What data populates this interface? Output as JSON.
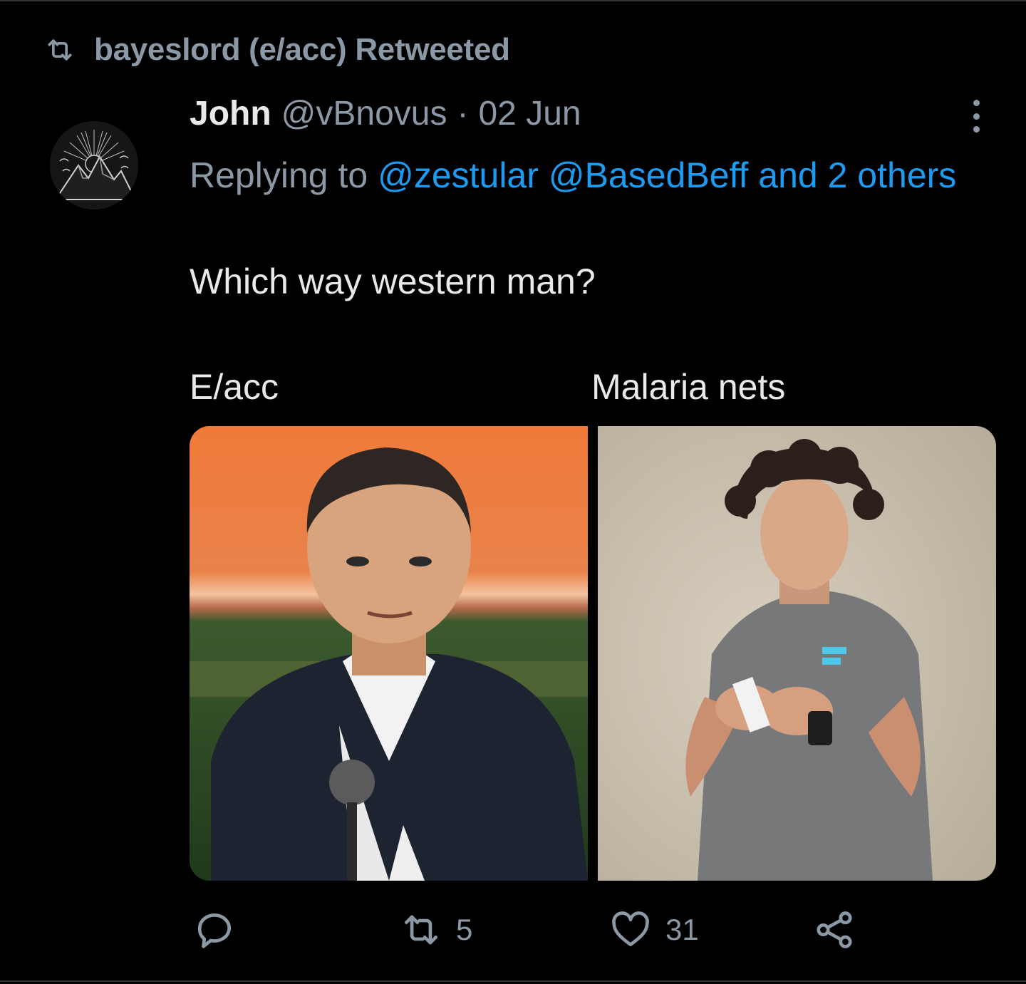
{
  "retweet_banner": {
    "text": "bayeslord (e/acc) Retweeted",
    "icon": "retweet-icon"
  },
  "tweet": {
    "author_name": "John",
    "author_handle": "@vBnovus",
    "separator": "·",
    "date": "02 Jun",
    "replying_prefix": "Replying to",
    "reply_mentions": [
      "@zestular",
      "@BasedBeff"
    ],
    "reply_others": "and 2 others",
    "text": "Which way western man?",
    "label_left": "E/acc",
    "label_right": "Malaria nets",
    "media": [
      {
        "icon": "photo-man-dark-suit-orange-background"
      },
      {
        "icon": "photo-man-curly-hair-grey-tshirt"
      }
    ]
  },
  "actions": {
    "reply": {
      "icon": "reply-icon",
      "count": ""
    },
    "retweet": {
      "icon": "retweet-icon",
      "count": "5"
    },
    "like": {
      "icon": "heart-icon",
      "count": "31"
    },
    "share": {
      "icon": "share-icon"
    }
  },
  "colors": {
    "background": "#000000",
    "text": "#e7e9ea",
    "muted": "#8b98a5",
    "link": "#1d9bf0",
    "divider": "#2f3336"
  }
}
